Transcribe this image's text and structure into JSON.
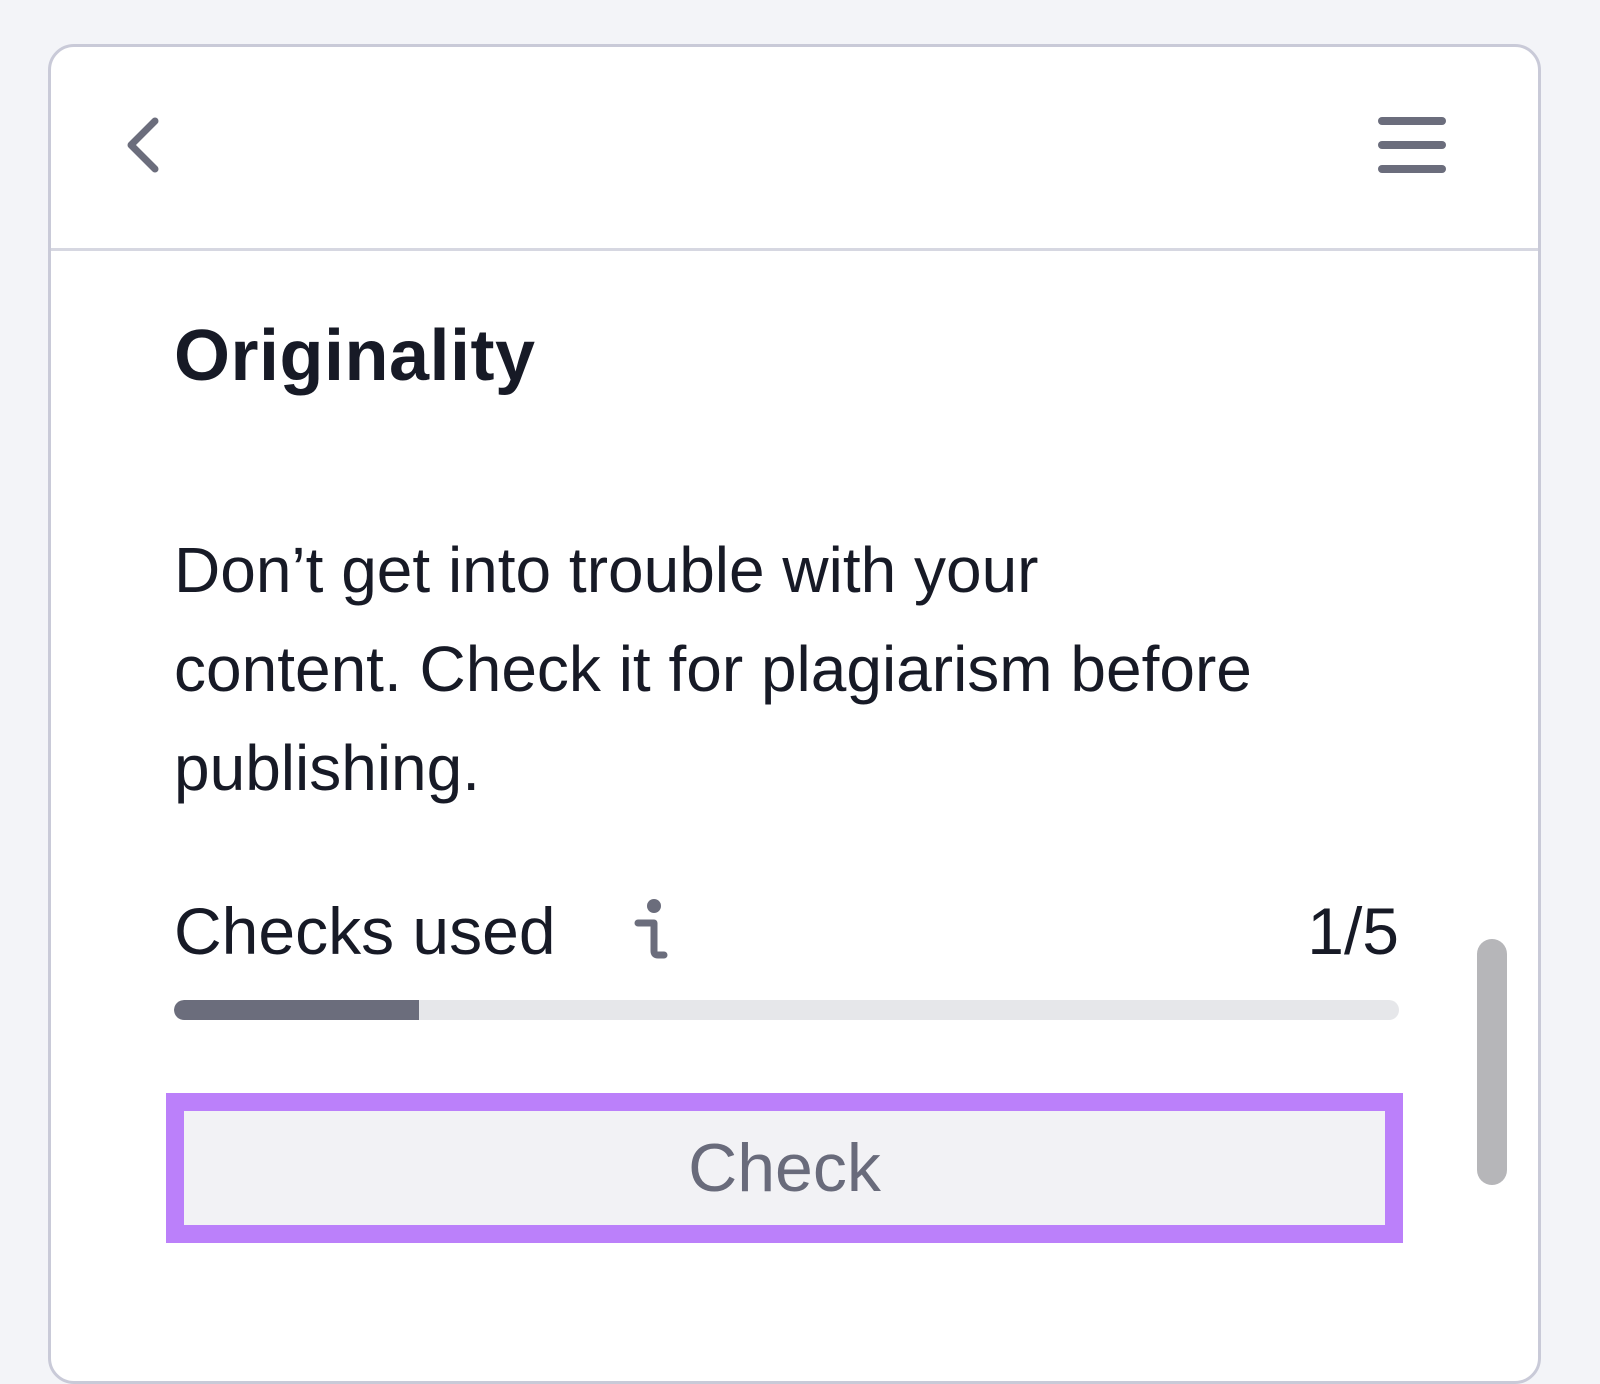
{
  "header": {
    "back_icon": "chevron-left-icon",
    "menu_icon": "hamburger-menu-icon"
  },
  "main": {
    "title": "Originality",
    "description": "Don’t get into trouble with your content. Check it for plagiarism before publishing.",
    "checks": {
      "label": "Checks used",
      "info_icon": "info-icon",
      "count_text": "1/5",
      "used": 1,
      "total": 5
    },
    "check_button_label": "Check"
  },
  "colors": {
    "background": "#f3f4f8",
    "panel": "#ffffff",
    "text": "#171a26",
    "icon": "#6b6d7c",
    "progress_fill": "#6b6d7c",
    "progress_track": "#e6e7ea",
    "highlight_outline": "#bb80fa",
    "button_background": "#f2f2f5",
    "button_text": "#696b7b",
    "scrollbar": "#b6b6b9"
  }
}
